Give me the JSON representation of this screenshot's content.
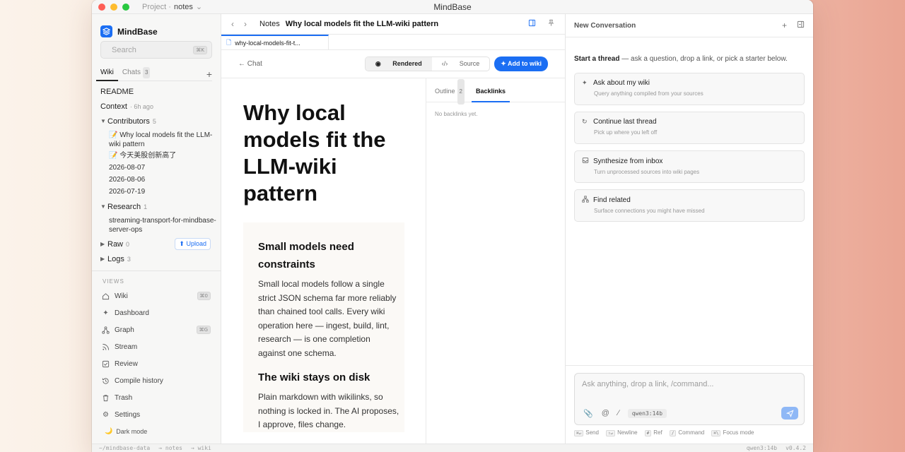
{
  "window": {
    "app_title": "MindBase",
    "project_label": "Project ·",
    "project_name": "notes",
    "project_caret": "⌄"
  },
  "sidebar": {
    "brand": "MindBase",
    "search_placeholder": "Search",
    "search_shortcut": "⌘K",
    "tabs": [
      {
        "label": "Wiki"
      },
      {
        "label": "Chats",
        "count": "3"
      }
    ],
    "add_label": "+",
    "tree": {
      "readme": "README",
      "context": {
        "label": "Context",
        "meta": "· 6h ago"
      },
      "contributors": {
        "label": "Contributors",
        "count": "5",
        "items": [
          "Why local models fit the LLM-wiki pattern",
          "今天美股创新高了",
          "2026-08-07",
          "2026-08-06",
          "2026-07-19"
        ]
      },
      "research": {
        "label": "Research",
        "count": "1",
        "items": [
          "streaming-transport-for-mindbase-server-ops"
        ]
      },
      "raw": {
        "label": "Raw",
        "count": "0",
        "upload": "Upload"
      },
      "logs": {
        "label": "Logs",
        "count": "3"
      }
    },
    "views_label": "VIEWS",
    "views": [
      {
        "label": "Wiki",
        "icon": "home-icon",
        "shortcut": "⌘0"
      },
      {
        "label": "Dashboard",
        "icon": "sparkle-icon"
      },
      {
        "label": "Graph",
        "icon": "graph-icon",
        "shortcut": "⌘G"
      },
      {
        "label": "Stream",
        "icon": "rss-icon"
      },
      {
        "label": "Review",
        "icon": "checkbox-icon"
      },
      {
        "label": "Compile history",
        "icon": "history-icon"
      },
      {
        "label": "Trash",
        "icon": "trash-icon"
      },
      {
        "label": "Settings",
        "icon": "gear-icon"
      }
    ],
    "dark_mode": "Dark mode"
  },
  "center": {
    "breadcrumb": {
      "parent": "Notes",
      "current": "Why local models fit the LLM-wiki pattern"
    },
    "doc_tab": "why-local-models-fit-t...",
    "chat_link": "Chat",
    "view_toggle": {
      "rendered": "Rendered",
      "source": "Source"
    },
    "add_to_wiki": "Add to wiki",
    "article": {
      "title": "Why local models fit the LLM-wiki pattern",
      "sections": [
        {
          "heading": "Small models need constraints",
          "body": "Small local models follow a single strict JSON schema far more reliably than chained tool calls. Every wiki operation here — ingest, build, lint, research — is one completion against one schema."
        },
        {
          "heading": "The wiki stays on disk",
          "body": "Plain markdown with wikilinks, so nothing is locked in. The AI proposes, I approve, files change."
        }
      ]
    },
    "side_panel": {
      "tabs": [
        {
          "label": "Outline",
          "count": "2"
        },
        {
          "label": "Backlinks"
        }
      ],
      "empty": "No backlinks yet."
    }
  },
  "chat": {
    "title": "New Conversation",
    "intro_bold": "Start a thread",
    "intro_rest": " — ask a question, drop a link, or pick a starter below.",
    "starters": [
      {
        "title": "Ask about my wiki",
        "desc": "Query anything compiled from your sources",
        "icon": "sparkle-icon"
      },
      {
        "title": "Continue last thread",
        "desc": "Pick up where you left off",
        "icon": "refresh-icon"
      },
      {
        "title": "Synthesize from inbox",
        "desc": "Turn unprocessed sources into wiki pages",
        "icon": "inbox-icon"
      },
      {
        "title": "Find related",
        "desc": "Surface connections you might have missed",
        "icon": "network-icon"
      }
    ],
    "composer": {
      "placeholder": "Ask anything, drop a link, /command...",
      "model": "qwen3:14b"
    },
    "hints": [
      {
        "key": "⌘↵",
        "label": "Send"
      },
      {
        "key": "⇧↵",
        "label": "Newline"
      },
      {
        "key": "#",
        "label": "Ref"
      },
      {
        "key": "/",
        "label": "Command"
      },
      {
        "key": "⌘\\",
        "label": "Focus mode"
      }
    ]
  },
  "statusbar": {
    "left": [
      "~/mindbase-data",
      "→ notes",
      "→ wiki"
    ],
    "right": [
      "qwen3:14b",
      "v0.4.2"
    ]
  },
  "colors": {
    "accent": "#1b6ef3"
  }
}
